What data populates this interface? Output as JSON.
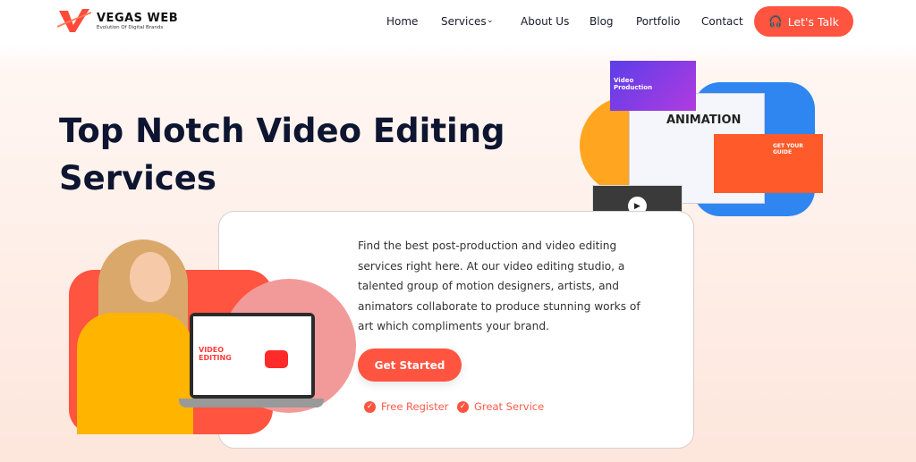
{
  "brand": {
    "name": "VEGAS WEB",
    "tagline": "Evolution Of Digital Brands",
    "accent": "#ff5440"
  },
  "nav": {
    "items": [
      {
        "label": "Home"
      },
      {
        "label": "Services"
      },
      {
        "label": "About Us"
      },
      {
        "label": "Blog"
      },
      {
        "label": "Portfolio"
      },
      {
        "label": "Contact"
      }
    ],
    "cta": "Let's Talk",
    "cta_icon": "headset-icon"
  },
  "hero": {
    "title": "Top Notch Video Editing Services",
    "description": "Find the best post-production and video editing services right here. At our video editing studio, a talented group of motion designers, artists, and animators collaborate to produce stunning works of art which compliments your brand.",
    "cta": "Get Started",
    "features": [
      "Free Register",
      "Great Service"
    ],
    "illustration_labels": {
      "video_production": "Video Production",
      "animation": "ANIMATION",
      "guide": "GET YOUR GUIDE",
      "video_editing": "VIDEO EDITING"
    }
  }
}
